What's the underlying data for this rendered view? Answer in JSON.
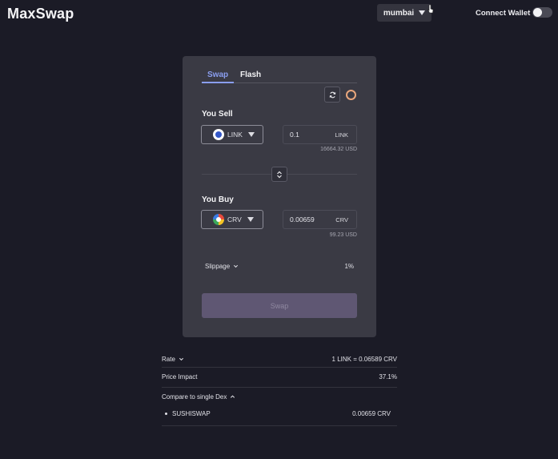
{
  "header": {
    "logo": "MaxSwap",
    "network": "mumbai",
    "connect_label": "Connect Wallet"
  },
  "tabs": [
    "Swap",
    "Flash"
  ],
  "sell": {
    "label": "You Sell",
    "token": "LINK",
    "amount": "0.1",
    "unit": "LINK",
    "usd": "16664.32 USD"
  },
  "buy": {
    "label": "You Buy",
    "token": "CRV",
    "amount": "0.00659",
    "unit": "CRV",
    "usd": "99.23 USD"
  },
  "slippage": {
    "label": "Slippage",
    "value": "1%"
  },
  "swap_button": "Swap",
  "details": {
    "rate_label": "Rate",
    "rate_value": "1 LINK = 0.06589 CRV",
    "impact_label": "Price Impact",
    "impact_value": "37.1%",
    "compare_label": "Compare to single Dex",
    "dex": {
      "name": "SUSHISWAP",
      "value": "0.00659 CRV"
    }
  },
  "colors": {
    "accent": "#8a9ef0",
    "background": "#1b1b26",
    "card": "#3a3a44"
  }
}
